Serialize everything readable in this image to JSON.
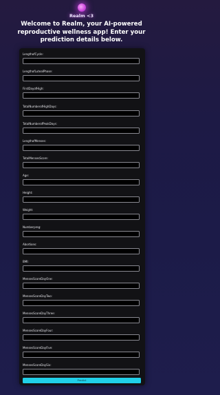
{
  "brand": {
    "name": "Realm <3",
    "logo_icon": "sparkle-orb-icon"
  },
  "headline": "Welcome to Realm, your AI-powered reproductive wellness app! Enter your prediction details below.",
  "form": {
    "fields": [
      {
        "label": "LengthofCycle:",
        "value": ""
      },
      {
        "label": "LengthofLutealPhase:",
        "value": ""
      },
      {
        "label": "FirstDayofHigh:",
        "value": ""
      },
      {
        "label": "TotalNumberofHighDays:",
        "value": ""
      },
      {
        "label": "TotalNumberofPeakDays:",
        "value": ""
      },
      {
        "label": "LengthofMenses:",
        "value": ""
      },
      {
        "label": "TotalMensesScore:",
        "value": ""
      },
      {
        "label": "Age:",
        "value": ""
      },
      {
        "label": "Height:",
        "value": ""
      },
      {
        "label": "Weight:",
        "value": ""
      },
      {
        "label": "Numberpreg:",
        "value": ""
      },
      {
        "label": "Abortions:",
        "value": ""
      },
      {
        "label": "BMI:",
        "value": ""
      },
      {
        "label": "MensesScoreDayOne:",
        "value": ""
      },
      {
        "label": "MensesScoreDayTwo:",
        "value": ""
      },
      {
        "label": "MensesScoreDayThree:",
        "value": ""
      },
      {
        "label": "MensesScoreDayFour:",
        "value": ""
      },
      {
        "label": "MensesScoreDayFive:",
        "value": ""
      },
      {
        "label": "MensesScoreDaySix:",
        "value": ""
      }
    ],
    "submit_label": "Predict"
  },
  "colors": {
    "accent": "#20cfe8",
    "card": "#121215",
    "logo_glow": "#d04ce0"
  }
}
